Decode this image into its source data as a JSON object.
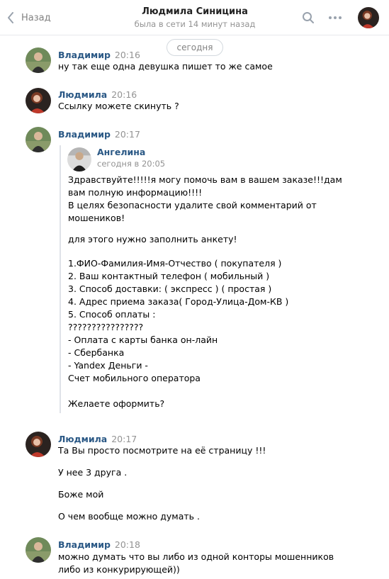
{
  "header": {
    "back_label": "Назад",
    "title": "Людмила Синицина",
    "subtitle": "была в сети 14 минут назад"
  },
  "date_divider": "сегодня",
  "messages": [
    {
      "author": "Владимир",
      "time": "20:16",
      "lines": [
        "ну так еще одна девушка пишет то же самое"
      ]
    },
    {
      "author": "Людмила",
      "time": "20:16",
      "lines": [
        "Ссылку можете скинуть ?"
      ]
    },
    {
      "author": "Владимир",
      "time": "20:17",
      "lines": []
    },
    {
      "author": "Людмила",
      "time": "20:17",
      "lines": [
        "Та Вы просто посмотрите на её страницу !!!",
        "У нее 3 друга .",
        "Боже мой",
        "О чем вообще можно думать ."
      ]
    },
    {
      "author": "Владимир",
      "time": "20:18",
      "lines": [
        "можно думать что вы либо из одной конторы мошенников",
        "либо из конкурирующей))"
      ]
    }
  ],
  "forwarded": {
    "author": "Ангелина",
    "time": "сегодня в 20:05",
    "lines": [
      "Здравствуйте!!!!!я могу помочь вам в вашем заказе!!!дам",
      "вам полную информацию!!!!",
      "В целях безопасности удалите свой комментарий от",
      "мошеников!",
      "для этого нужно заполнить анкету!",
      "1.ФИО-Фамилия-Имя-Отчество ( покупателя )",
      "2. Ваш контактный телефон ( мобильный )",
      "3. Способ доставки: ( экспресс ) ( простая )",
      "4. Адрес приема заказа( Город-Улица-Дом-КВ )",
      "5. Способ оплаты :",
      "????????????????",
      "- Оплата с карты банка он-лайн",
      "- Сбербанка",
      "- Yandex Деньги -",
      "Счет мобильного оператора",
      "Желаете оформить?"
    ]
  }
}
